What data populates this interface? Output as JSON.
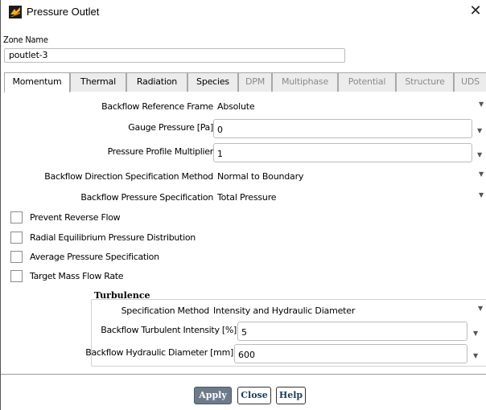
{
  "window": {
    "title": "Pressure Outlet",
    "close_glyph": "✕"
  },
  "zone": {
    "label": "Zone Name",
    "value": "poutlet-3"
  },
  "tabs": [
    {
      "label": "Momentum",
      "state": "active"
    },
    {
      "label": "Thermal",
      "state": "enabled"
    },
    {
      "label": "Radiation",
      "state": "enabled"
    },
    {
      "label": "Species",
      "state": "enabled"
    },
    {
      "label": "DPM",
      "state": "disabled"
    },
    {
      "label": "Multiphase",
      "state": "disabled"
    },
    {
      "label": "Potential",
      "state": "disabled"
    },
    {
      "label": "Structure",
      "state": "disabled"
    },
    {
      "label": "UDS",
      "state": "disabled"
    }
  ],
  "momentum": {
    "backflow_ref_frame": {
      "label": "Backflow Reference Frame",
      "value": "Absolute"
    },
    "gauge_pressure": {
      "label": "Gauge Pressure [Pa]",
      "value": "0"
    },
    "profile_multiplier": {
      "label": "Pressure Profile Multiplier",
      "value": "1"
    },
    "backflow_direction": {
      "label": "Backflow Direction Specification Method",
      "value": "Normal to Boundary"
    },
    "backflow_pressure": {
      "label": "Backflow Pressure Specification",
      "value": "Total Pressure"
    }
  },
  "checkboxes": [
    {
      "label": "Prevent Reverse Flow",
      "checked": false
    },
    {
      "label": "Radial Equilibrium Pressure Distribution",
      "checked": false
    },
    {
      "label": "Average Pressure Specification",
      "checked": false
    },
    {
      "label": "Target Mass Flow Rate",
      "checked": false
    }
  ],
  "turbulence": {
    "heading": "Turbulence",
    "spec_method": {
      "label": "Specification Method",
      "value": "Intensity and Hydraulic Diameter"
    },
    "intensity": {
      "label": "Backflow Turbulent Intensity [%]",
      "value": "5"
    },
    "diameter": {
      "label": "Backflow Hydraulic Diameter [mm]",
      "value": "600"
    }
  },
  "buttons": {
    "apply": "Apply",
    "close": "Close",
    "help": "Help"
  },
  "icons": {
    "dropdown": "▼",
    "app": "fluent-boundary-icon"
  },
  "colors": {
    "apply_bg": "#6d7a8a",
    "button_text": "#1d3a5f",
    "disabled_text": "#8a8a8a"
  }
}
